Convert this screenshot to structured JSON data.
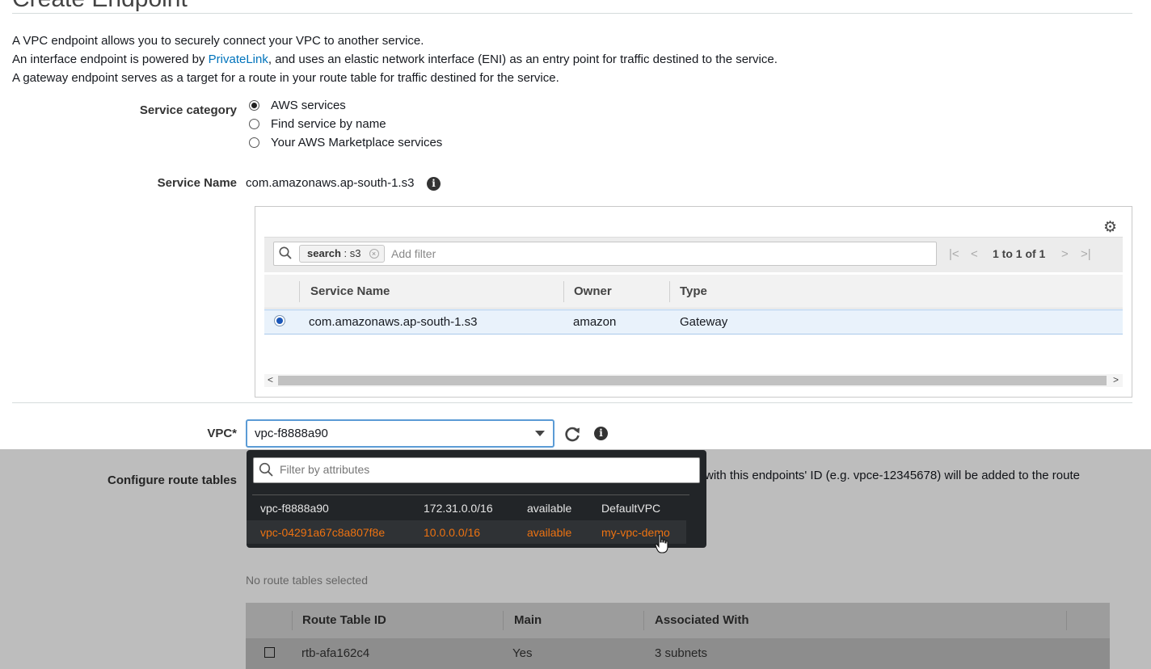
{
  "page": {
    "title": "Create Endpoint"
  },
  "intro": {
    "line1": "A VPC endpoint allows you to securely connect your VPC to another service.",
    "line2_before": "An interface endpoint is powered by ",
    "line2_link": "PrivateLink",
    "line2_after": ", and uses an elastic network interface (ENI) as an entry point for traffic destined to the service.",
    "line3": "A gateway endpoint serves as a target for a route in your route table for traffic destined for the service."
  },
  "service_category": {
    "label": "Service category",
    "options": [
      {
        "label": "AWS services",
        "selected": true
      },
      {
        "label": "Find service by name",
        "selected": false
      },
      {
        "label": "Your AWS Marketplace services",
        "selected": false
      }
    ]
  },
  "service_name": {
    "label": "Service Name",
    "value": "com.amazonaws.ap-south-1.s3",
    "info_icon": "info-icon"
  },
  "service_table": {
    "settings_icon": "gear-icon",
    "search": {
      "token_key": "search",
      "token_sep": " : ",
      "token_value": "s3",
      "placeholder": "Add filter"
    },
    "pagination": {
      "text": "1 to 1 of 1"
    },
    "columns": [
      "Service Name",
      "Owner",
      "Type"
    ],
    "rows": [
      {
        "service_name": "com.amazonaws.ap-south-1.s3",
        "owner": "amazon",
        "type": "Gateway",
        "selected": true
      }
    ]
  },
  "vpc": {
    "label": "VPC*",
    "selected": "vpc-f8888a90",
    "dropdown": {
      "filter_placeholder": "Filter by attributes",
      "options": [
        {
          "id": "vpc-f8888a90",
          "cidr": "172.31.0.0/16",
          "state": "available",
          "name": "DefaultVPC",
          "highlighted": false
        },
        {
          "id": "vpc-04291a67c8a807f8e",
          "cidr": "10.0.0.0/16",
          "state": "available",
          "name": "my-vpc-demo",
          "highlighted": true
        }
      ]
    }
  },
  "route_tables": {
    "label": "Configure route tables",
    "note": "with this endpoints' ID (e.g. vpce-12345678) will be added to the route",
    "empty_text": "No route tables selected",
    "columns": [
      "Route Table ID",
      "Main",
      "Associated With"
    ],
    "rows": [
      {
        "id": "rtb-afa162c4",
        "main": "Yes",
        "associated": "3 subnets"
      }
    ]
  },
  "colors": {
    "link": "#0073bb",
    "highlight_orange": "#ec7211",
    "selected_row": "#e9f2fb",
    "menu_bg": "#222528"
  }
}
